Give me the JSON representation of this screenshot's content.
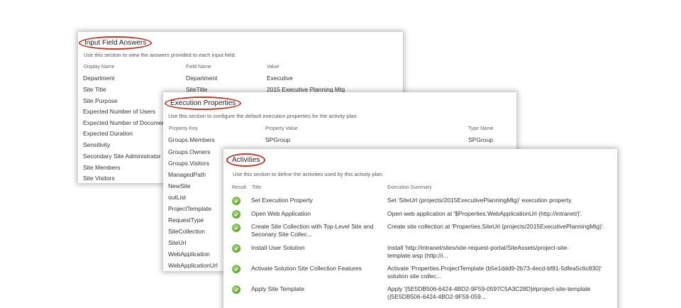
{
  "input_field_answers": {
    "title": "Input Field Answers",
    "description": "Use this section to view the answers provided to each input field.",
    "columns": [
      "Display Name",
      "Field Name",
      "Value"
    ],
    "rows": [
      {
        "display": "Department",
        "field": "Department",
        "value": "Executive"
      },
      {
        "display": "Site Title",
        "field": "SiteTitle",
        "value": "2015 Executive Planning Mtg"
      },
      {
        "display": "Site Purpose",
        "field": "",
        "value": ""
      },
      {
        "display": "Expected Number of Users",
        "field": "",
        "value": ""
      },
      {
        "display": "Expected Number of Documents",
        "field": "",
        "value": ""
      },
      {
        "display": "Expected Duration",
        "field": "",
        "value": ""
      },
      {
        "display": "Sensitivity",
        "field": "",
        "value": ""
      },
      {
        "display": "Secondary Site Administrator",
        "field": "",
        "value": ""
      },
      {
        "display": "Site Members",
        "field": "",
        "value": ""
      },
      {
        "display": "Site Visitors",
        "field": "",
        "value": ""
      }
    ]
  },
  "execution_properties": {
    "title": "Execution Properties",
    "description": "Use this section to configure the default execution properties for the activity plan.",
    "columns": [
      "Property Key",
      "Property Value",
      "Type Name"
    ],
    "rows": [
      {
        "key": "Groups.Members",
        "value": "SPGroup",
        "type": "SPGroup"
      },
      {
        "key": "Groups.Owners",
        "value": "",
        "type": ""
      },
      {
        "key": "Groups.Visitors",
        "value": "",
        "type": ""
      },
      {
        "key": "ManagedPath",
        "value": "",
        "type": ""
      },
      {
        "key": "NewSite",
        "value": "",
        "type": ""
      },
      {
        "key": "outList",
        "value": "",
        "type": ""
      },
      {
        "key": "ProjectTemplate",
        "value": "",
        "type": ""
      },
      {
        "key": "RequestType",
        "value": "",
        "type": ""
      },
      {
        "key": "SiteCollection",
        "value": "",
        "type": ""
      },
      {
        "key": "SiteUrl",
        "value": "",
        "type": ""
      },
      {
        "key": "WebApplication",
        "value": "",
        "type": ""
      },
      {
        "key": "WebApplicationUrl",
        "value": "",
        "type": ""
      }
    ]
  },
  "activities": {
    "title": "Activities",
    "description": "Use this section to define the activities used by this activity plan.",
    "columns": [
      "Result",
      "Title",
      "Execution Summary"
    ],
    "result_icon": "success-check-icon",
    "result_color": "#5aa92e",
    "rows": [
      {
        "title": "Set Execution Property",
        "summary": "Set 'SiteUrl (projects/2015ExecutivePlanningMtg)' execution property."
      },
      {
        "title": "Open Web Application",
        "summary": "Open web application at '$Properties.WebApplicationUrl (http://intranet/)'."
      },
      {
        "title": "Create Site Collection with Top-Level Site and Seconary Site Collec...",
        "summary": "Create site collection at 'Properties.SiteUrl (projects/2015ExecutivePlanningMtg)'."
      },
      {
        "title": "Install User Solution",
        "summary": "Install 'http://intranet/sites/site-request-portal/SiteAssets/project-site-template.wsp (http://i..."
      },
      {
        "title": "Activate Solution Site Collection Features",
        "summary": "Activate 'Properties.ProjectTemplate (b5e1ddd9-2b73-4ecd-bf81-5dfea5c6c830)' solution site collec..."
      },
      {
        "title": "Apply Site Template",
        "summary": "Apply '{5E5DB506-6424-4BD2-9F59-0597C5A3C28D}#project-site-template ({5E5DB506-6424-4BD2-9F59-059..."
      }
    ]
  }
}
